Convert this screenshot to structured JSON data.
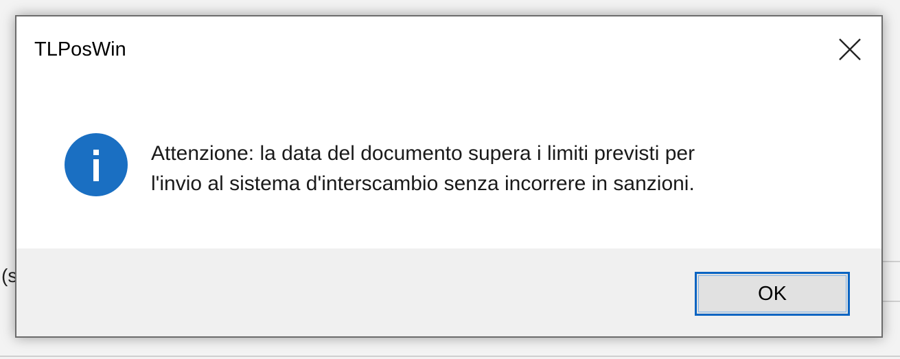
{
  "dialog": {
    "title": "TLPosWin",
    "close_icon": "close-icon",
    "icon": "info-icon",
    "accent_color": "#1a6fc2",
    "message_lines": [
      "Attenzione: la data del documento supera i limiti previsti per",
      "l'invio al sistema d'interscambio senza incorrere in sanzioni."
    ],
    "ok_label": "OK"
  },
  "background": {
    "fragment_text": "(s"
  }
}
